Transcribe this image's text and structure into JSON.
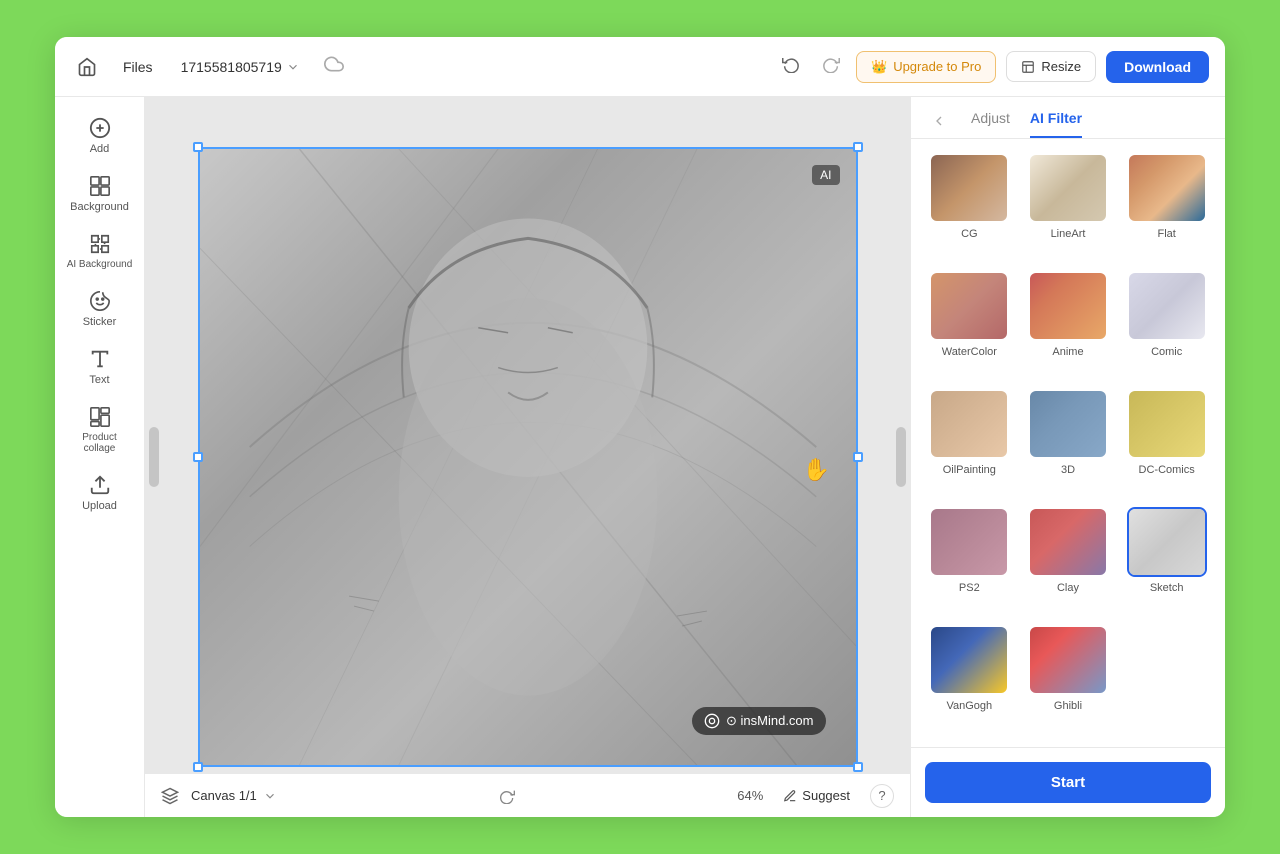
{
  "app": {
    "title": "insMind"
  },
  "header": {
    "home_label": "🏠",
    "files_label": "Files",
    "filename": "1715581805719",
    "undo_label": "↺",
    "redo_label": "↻",
    "upgrade_label": "Upgrade to Pro",
    "resize_label": "Resize",
    "download_label": "Download",
    "cloud_icon": "☁"
  },
  "sidebar": {
    "items": [
      {
        "id": "add",
        "label": "Add",
        "icon": "plus-circle"
      },
      {
        "id": "background",
        "label": "Background",
        "icon": "grid"
      },
      {
        "id": "ai-background",
        "label": "AI Background",
        "icon": "sparkle-grid"
      },
      {
        "id": "sticker",
        "label": "Sticker",
        "icon": "sticker"
      },
      {
        "id": "text",
        "label": "Text",
        "icon": "text-t"
      },
      {
        "id": "product-collage",
        "label": "Product collage",
        "icon": "collage"
      },
      {
        "id": "upload",
        "label": "Upload",
        "icon": "upload"
      }
    ]
  },
  "canvas": {
    "info": "Canvas 1/1",
    "zoom": "64%",
    "ai_badge": "AI"
  },
  "float_toolbar": {
    "buttons": [
      {
        "id": "ai-enhance",
        "label": "AI",
        "has_new": true
      },
      {
        "id": "crop",
        "label": "⊡"
      },
      {
        "id": "flip",
        "label": "⧉"
      },
      {
        "id": "delete",
        "label": "🗑"
      },
      {
        "id": "more",
        "label": "···"
      }
    ]
  },
  "watermark": {
    "text": "⊙ insMind.com"
  },
  "panel": {
    "back_icon": "‹",
    "tabs": [
      {
        "id": "adjust",
        "label": "Adjust",
        "active": false
      },
      {
        "id": "ai-filter",
        "label": "AI Filter",
        "active": true
      }
    ],
    "filters": [
      {
        "id": "cg",
        "label": "CG",
        "class": "ft-cg",
        "selected": false
      },
      {
        "id": "lineart",
        "label": "LineArt",
        "class": "ft-lineart",
        "selected": false
      },
      {
        "id": "flat",
        "label": "Flat",
        "class": "ft-flat",
        "selected": false
      },
      {
        "id": "watercolor",
        "label": "WaterColor",
        "class": "ft-watercolor",
        "selected": false
      },
      {
        "id": "anime",
        "label": "Anime",
        "class": "ft-anime",
        "selected": false
      },
      {
        "id": "comic",
        "label": "Comic",
        "class": "ft-comic",
        "selected": false
      },
      {
        "id": "oilpainting",
        "label": "OilPainting",
        "class": "ft-oilpainting",
        "selected": false
      },
      {
        "id": "3d",
        "label": "3D",
        "class": "ft-3d",
        "selected": false
      },
      {
        "id": "dccomics",
        "label": "DC-Comics",
        "class": "ft-dccomics",
        "selected": false
      },
      {
        "id": "ps2",
        "label": "PS2",
        "class": "ft-ps2",
        "selected": false
      },
      {
        "id": "clay",
        "label": "Clay",
        "class": "ft-clay",
        "selected": false
      },
      {
        "id": "sketch",
        "label": "Sketch",
        "class": "ft-sketch",
        "selected": true
      },
      {
        "id": "vangogh",
        "label": "VanGogh",
        "class": "ft-vangogh",
        "selected": false
      },
      {
        "id": "ghibli",
        "label": "Ghibli",
        "class": "ft-ghibli",
        "selected": false
      }
    ],
    "start_label": "Start"
  },
  "bottom_bar": {
    "canvas_info": "Canvas 1/1",
    "zoom": "64%",
    "suggest_label": "Suggest",
    "help_label": "?"
  }
}
